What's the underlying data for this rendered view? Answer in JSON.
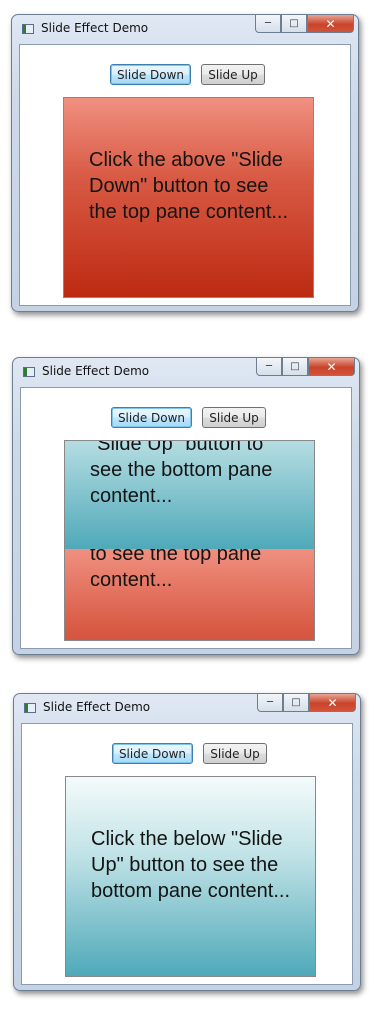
{
  "windows": [
    {
      "title": "Slide Effect Demo",
      "buttons": {
        "slide_down": "Slide Down",
        "slide_up": "Slide Up"
      },
      "top_pane_text": "Click the above \"Slide Down\" button to see the top pane content...",
      "bottom_pane_text": ""
    },
    {
      "title": "Slide Effect Demo",
      "buttons": {
        "slide_down": "Slide Down",
        "slide_up": "Slide Up"
      },
      "top_pane_text": "\"Slide Up\" button to see the bottom pane content...",
      "bottom_pane_text": "to see the top pane content..."
    },
    {
      "title": "Slide Effect Demo",
      "buttons": {
        "slide_down": "Slide Down",
        "slide_up": "Slide Up"
      },
      "top_pane_text": "Click the below \"Slide Up\" button to see the bottom pane content...",
      "bottom_pane_text": ""
    }
  ],
  "colors": {
    "red_pane_top": "#f09080",
    "red_pane_bottom": "#bd2a12",
    "teal_pane_top": "#f4fbfb",
    "teal_pane_bottom": "#4fa9b9",
    "focus_border": "#3c7fb1"
  },
  "icons": {
    "window_icon": "app-window-icon",
    "minimize": "minimize-icon",
    "maximize": "maximize-icon",
    "close": "close-icon"
  }
}
